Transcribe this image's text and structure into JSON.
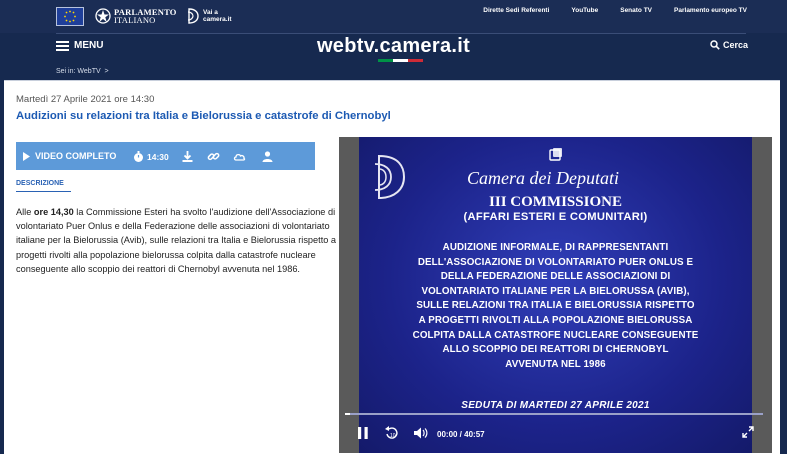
{
  "top": {
    "parliament_line1": "PARLAMENTO",
    "parliament_line2": "ITALIANO",
    "vai_line1": "Vai a",
    "vai_line2": "camera.it",
    "links": [
      "Dirette Sedi Referenti",
      "YouTube",
      "Senato TV",
      "Parlamento europeo TV"
    ]
  },
  "header": {
    "menu_label": "MENU",
    "site_title": "webtv.camera.it",
    "search_label": "Cerca",
    "breadcrumb_prefix": "Sei in:",
    "breadcrumb_item": "WebTV",
    "breadcrumb_sep": ">"
  },
  "content": {
    "date": "Martedì 27 Aprile 2021 ore 14:30",
    "title": "Audizioni su relazioni tra Italia e Bielorussia e catastrofe di Chernobyl",
    "video_complete_label": "VIDEO COMPLETO",
    "duration": "14:30",
    "description_tab": "DESCRIZIONE",
    "desc_before": "Alle ",
    "desc_bold": "ore 14,30",
    "desc_after": " la Commissione Esteri ha svolto l'audizione dell'Associazione di volontariato Puer Onlus e della Federazione delle associazioni di volontariato italiane per la Bielorussia (Avib), sulle relazioni tra Italia e Bielorussia rispetto a progetti rivolti alla popolazione bielorussa colpita dalla catastrofe nucleare conseguente allo scoppio dei reattori di Chernobyl avvenuta nel 1986."
  },
  "video": {
    "camera_title": "Camera dei Deputati",
    "commission": "III COMMISSIONE",
    "commission_sub": "(AFFARI ESTERI E COMUNITARI)",
    "lines": [
      "AUDIZIONE INFORMALE, DI RAPPRESENTANTI",
      "DELL'ASSOCIAZIONE DI VOLONTARIATO PUER ONLUS E",
      "DELLA FEDERAZIONE DELLE ASSOCIAZIONI DI",
      "VOLONTARIATO ITALIANE PER LA BIELORUSSA (AVIB),",
      "SULLE RELAZIONI TRA ITALIA E BIELORUSSIA RISPETTO",
      "A PROGETTI RIVOLTI ALLA POPOLAZIONE BIELORUSSA",
      "COLPITA DALLA CATASTROFE NUCLEARE CONSEGUENTE",
      "ALLO SCOPPIO DEI REATTORI DI CHERNOBYL",
      "AVVENUTA NEL 1986"
    ],
    "seduta": "SEDUTA DI MARTEDI 27 APRILE 2021",
    "time_display": "00:00 / 40:57",
    "progress_fraction": 0.0
  },
  "colors": {
    "top_bg": "#1b2d55",
    "accent_blue": "#1c5ab3",
    "video_bar": "#5d9ad9",
    "tricolor": [
      "#009246",
      "#ffffff",
      "#ce2b37"
    ]
  }
}
